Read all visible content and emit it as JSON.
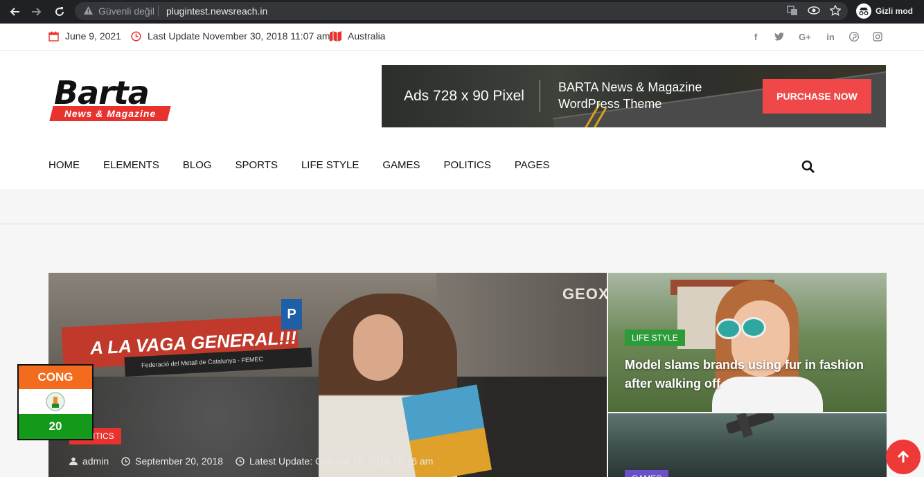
{
  "browser": {
    "insecure_label": "Güvenli değil",
    "url": "plugintest.newsreach.in",
    "incognito_label": "Gizli mod"
  },
  "topbar": {
    "date": "June 9, 2021",
    "last_update": "Last Update November 30, 2018 11:07 am",
    "location": "Australia",
    "accent": "#e8322e"
  },
  "logo": {
    "title": "Barta",
    "subtitle": "News & Magazine"
  },
  "ad": {
    "size_label": "Ads 728 x 90 Pixel",
    "headline_line1": "BARTA News & Magazine",
    "headline_line2": "WordPress Theme",
    "button": "PURCHASE NOW"
  },
  "nav": {
    "items": [
      "HOME",
      "ELEMENTS",
      "BLOG",
      "SPORTS",
      "LIFE STYLE",
      "GAMES",
      "POLITICS",
      "PAGES"
    ]
  },
  "hero": {
    "main": {
      "category": "POLITICS",
      "author": "admin",
      "date": "September 20, 2018",
      "updated": "Latest Update: October 16, 2018 10:16 am",
      "banner_text": "A LA VAGA GENERAL!!!",
      "banner_sub": "Federació del Metall de Catalunya - FEMEC",
      "sign": "GEOX"
    },
    "side1": {
      "category": "LIFE STYLE",
      "title": "Model slams brands using fur in fashion after walking off"
    },
    "side2": {
      "category": "GAMES"
    }
  },
  "widget": {
    "party": "CONG",
    "count": "20"
  }
}
